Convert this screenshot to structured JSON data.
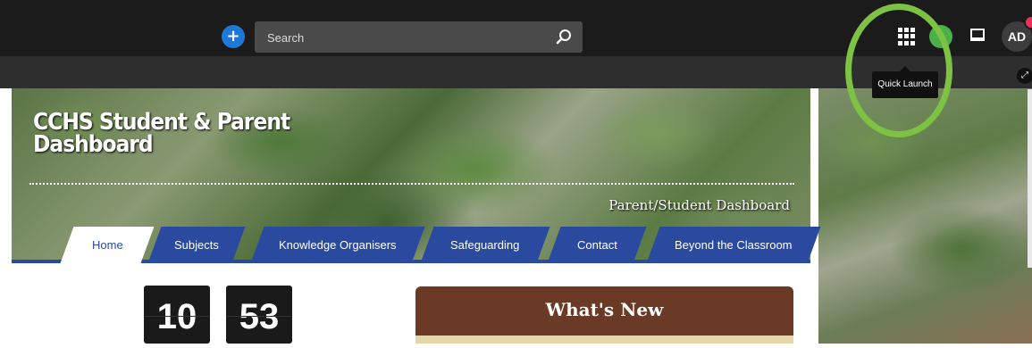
{
  "topbar": {
    "add_icon": "plus-icon",
    "search_placeholder": "Search",
    "search_icon": "search-icon",
    "quick_launch_icon": "grid-icon",
    "avatar_initials": "AD",
    "colors": {
      "bar": "#1b1b1b",
      "accent": "#1e78d6",
      "green": "#4bb04a",
      "notification": "#e8305a"
    }
  },
  "tooltip": {
    "text": "Quick Launch"
  },
  "banner": {
    "title": "CCHS Student & Parent Dashboard",
    "subtitle": "Parent/Student Dashboard"
  },
  "nav": {
    "tabs": [
      {
        "label": "Home",
        "active": true
      },
      {
        "label": "Subjects",
        "active": false
      },
      {
        "label": "Knowledge Organisers",
        "active": false
      },
      {
        "label": "Safeguarding",
        "active": false
      },
      {
        "label": "Contact",
        "active": false
      },
      {
        "label": "Beyond the Classroom",
        "active": false
      }
    ],
    "color": "#2a4a9f"
  },
  "clock": {
    "hours": "10",
    "minutes": "53"
  },
  "whats_new": {
    "title": "What's New",
    "header_color": "#6b3a26"
  }
}
